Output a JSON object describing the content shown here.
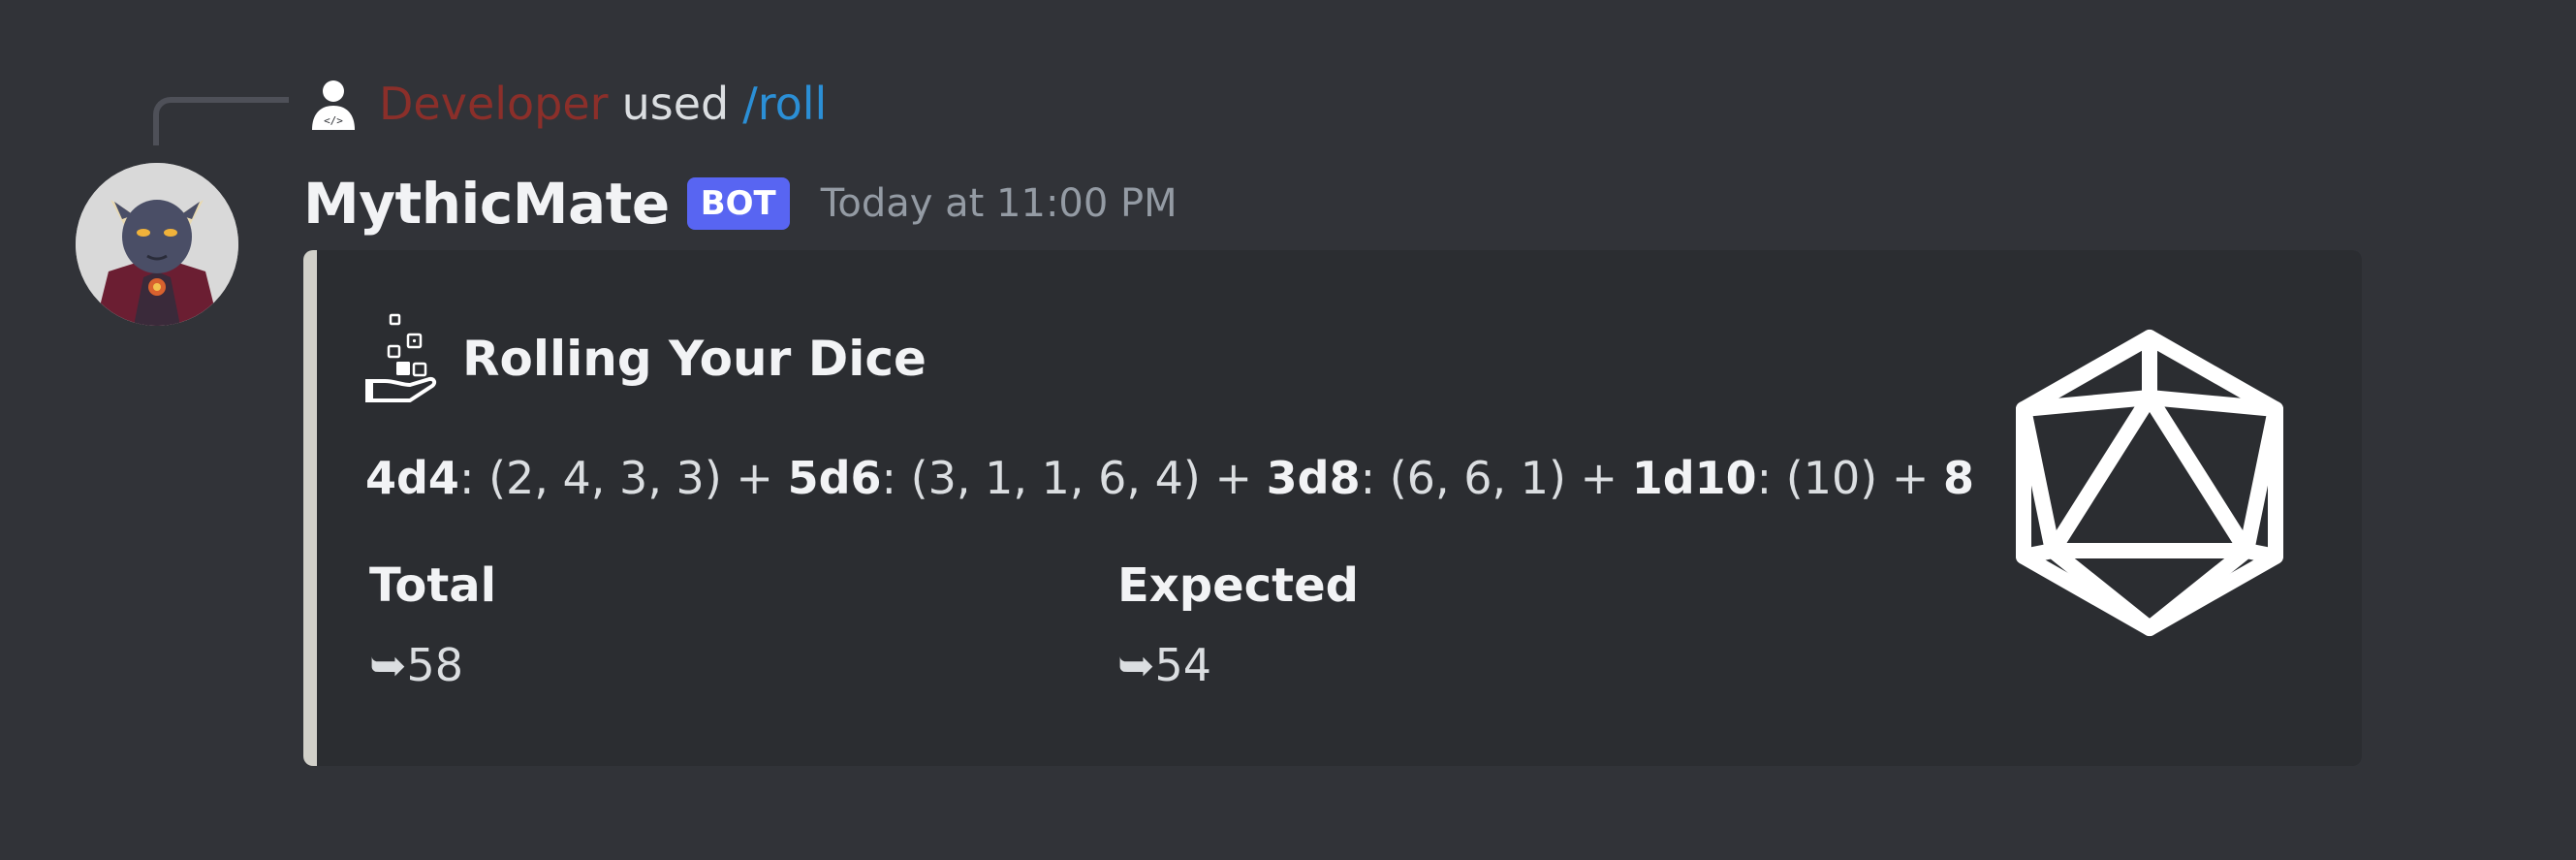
{
  "reply": {
    "user": "Developer",
    "used": "used",
    "command": "/roll",
    "icon": "developer-avatar-icon"
  },
  "message": {
    "username": "MythicMate",
    "tag": "BOT",
    "timestamp": "Today at 11:00 PM",
    "avatar": "cat-demon-avatar"
  },
  "embed": {
    "accent_color": "#d1d0c9",
    "author_icon": "hand-dice-icon",
    "title": "Rolling Your Dice",
    "description": {
      "g1_die": "4d4",
      "g1_sep": ": ",
      "g1_rolls": "(2, 4, 3, 3)",
      "plus1": " + ",
      "g2_die": "5d6",
      "g2_sep": ": ",
      "g2_rolls": "(3, 1, 1, 6, 4)",
      "plus2": " + ",
      "g3_die": "3d8",
      "g3_sep": ": ",
      "g3_rolls": "(6, 6, 1)",
      "plus3": " + ",
      "g4_die": "1d10",
      "g4_sep": ": ",
      "g4_rolls": "(10)",
      "plus4": " + ",
      "modifier": "8"
    },
    "fields": [
      {
        "name": "Total",
        "value": "➥58"
      },
      {
        "name": "Expected",
        "value": "➥54"
      }
    ],
    "thumbnail": "d20-icon"
  },
  "colors": {
    "background": "#313338",
    "embed_background": "#2b2d31",
    "bot_tag": "#5865f2",
    "command_link": "#2b8fd6",
    "reply_user": "#8b2f2a"
  }
}
